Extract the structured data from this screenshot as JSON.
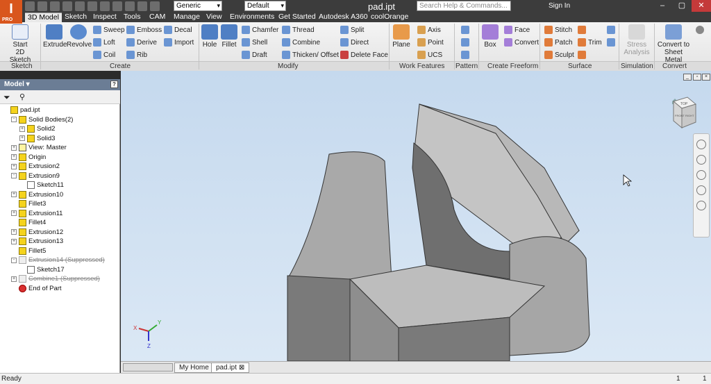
{
  "app": {
    "logo_text": "I",
    "logo_sub": "PRO",
    "doc_title": "pad.ipt",
    "material_select": "Generic",
    "appearance_select": "Default",
    "help_search_placeholder": "Search Help & Commands...",
    "sign_in": "Sign In"
  },
  "tabs": [
    "3D Model",
    "Sketch",
    "Inspect",
    "Tools",
    "CAM",
    "Manage",
    "View",
    "Environments",
    "Get Started",
    "Autodesk A360",
    "coolOrange"
  ],
  "ribbon": {
    "sketch": {
      "start_sketch": "Start",
      "start_sketch2": "2D Sketch",
      "label": "Sketch"
    },
    "create": {
      "label": "Create",
      "extrude": "Extrude",
      "revolve": "Revolve",
      "sweep": "Sweep",
      "loft": "Loft",
      "coil": "Coil",
      "emboss": "Emboss",
      "derive": "Derive",
      "rib": "Rib",
      "decal": "Decal",
      "import": "Import"
    },
    "modify": {
      "label": "Modify",
      "hole": "Hole",
      "fillet": "Fillet",
      "chamfer": "Chamfer",
      "shell": "Shell",
      "draft": "Draft",
      "thread": "Thread",
      "combine": "Combine",
      "thicken": "Thicken/ Offset",
      "split": "Split",
      "direct": "Direct",
      "delete_face": "Delete Face"
    },
    "work_features": {
      "label": "Work Features",
      "plane": "Plane",
      "axis": "Axis",
      "point": "Point",
      "ucs": "UCS"
    },
    "pattern": {
      "label": "Pattern"
    },
    "freeform": {
      "label": "Create Freeform",
      "box": "Box",
      "face": "Face",
      "convert": "Convert"
    },
    "surface": {
      "label": "Surface",
      "stitch": "Stitch",
      "patch": "Patch",
      "sculpt": "Sculpt",
      "trim": "Trim"
    },
    "simulation": {
      "label": "Simulation",
      "stress1": "Stress",
      "stress2": "Analysis"
    },
    "convert": {
      "label": "Convert",
      "c1": "Convert to",
      "c2": "Sheet Metal"
    }
  },
  "browser": {
    "header": "Model",
    "nodes": [
      {
        "label": "pad.ipt",
        "level": 0,
        "icon": "part",
        "exp": ""
      },
      {
        "label": "Solid Bodies(2)",
        "level": 1,
        "icon": "folder",
        "exp": "-"
      },
      {
        "label": "Solid2",
        "level": 2,
        "icon": "solid",
        "exp": "+"
      },
      {
        "label": "Solid3",
        "level": 2,
        "icon": "solid",
        "exp": "+"
      },
      {
        "label": "View: Master",
        "level": 1,
        "icon": "view",
        "exp": "+"
      },
      {
        "label": "Origin",
        "level": 1,
        "icon": "folder",
        "exp": "+"
      },
      {
        "label": "Extrusion2",
        "level": 1,
        "icon": "feature",
        "exp": "+"
      },
      {
        "label": "Extrusion9",
        "level": 1,
        "icon": "feature",
        "exp": "-"
      },
      {
        "label": "Sketch11",
        "level": 2,
        "icon": "sketch",
        "exp": ""
      },
      {
        "label": "Extrusion10",
        "level": 1,
        "icon": "feature",
        "exp": "+"
      },
      {
        "label": "Fillet3",
        "level": 1,
        "icon": "feature",
        "exp": ""
      },
      {
        "label": "Extrusion11",
        "level": 1,
        "icon": "feature",
        "exp": "+"
      },
      {
        "label": "Fillet4",
        "level": 1,
        "icon": "feature",
        "exp": ""
      },
      {
        "label": "Extrusion12",
        "level": 1,
        "icon": "feature",
        "exp": "+"
      },
      {
        "label": "Extrusion13",
        "level": 1,
        "icon": "feature",
        "exp": "+"
      },
      {
        "label": "Fillet5",
        "level": 1,
        "icon": "feature",
        "exp": ""
      },
      {
        "label": "Extrusion14 (Suppressed)",
        "level": 1,
        "icon": "suppressed",
        "exp": "-"
      },
      {
        "label": "Sketch17",
        "level": 2,
        "icon": "sketch",
        "exp": ""
      },
      {
        "label": "Combine1 (Suppressed)",
        "level": 1,
        "icon": "suppressed",
        "exp": "+"
      },
      {
        "label": "End of Part",
        "level": 1,
        "icon": "end",
        "exp": ""
      }
    ]
  },
  "viewcube": {
    "top": "TOP",
    "front": "FRONT",
    "right": "RIGHT"
  },
  "triad": {
    "x": "X",
    "y": "Y",
    "z": "Z"
  },
  "doc_tabs": {
    "home": "My Home",
    "doc": "pad.ipt"
  },
  "status": {
    "text": "Ready",
    "n1": "1",
    "n2": "1"
  }
}
